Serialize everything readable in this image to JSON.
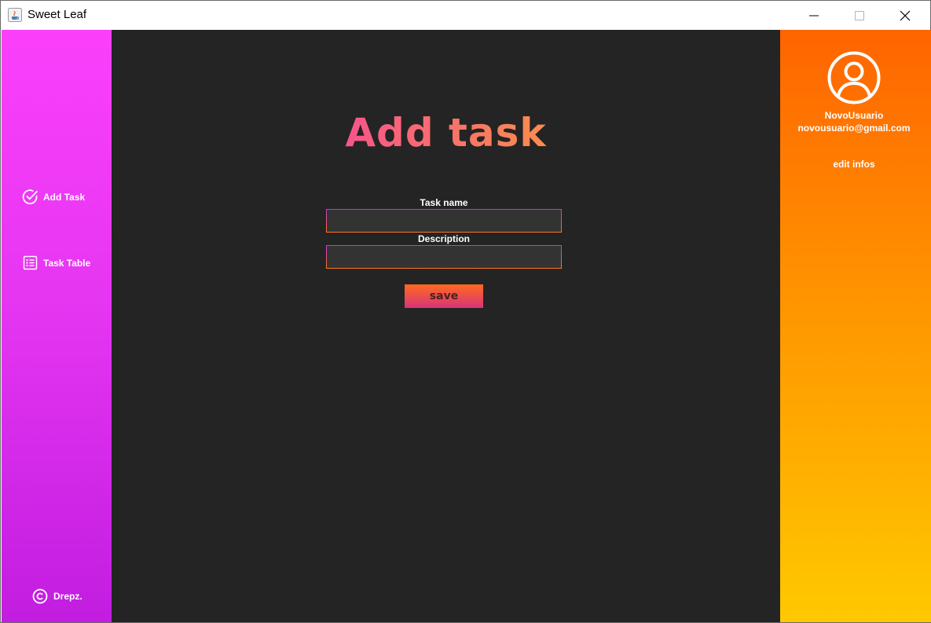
{
  "window": {
    "title": "Sweet Leaf",
    "icon": "java-cup-icon"
  },
  "sidebar": {
    "items": [
      {
        "label": "Add Task",
        "icon": "check-circle-icon"
      },
      {
        "label": "Task Table",
        "icon": "list-icon"
      }
    ],
    "credit": {
      "label": "Drepz.",
      "icon": "copyright-icon"
    },
    "color_top": "#fb3ffb",
    "color_bottom": "#c21de0"
  },
  "main": {
    "title": "Add task",
    "fields": [
      {
        "label": "Task name",
        "value": "",
        "placeholder": ""
      },
      {
        "label": "Description",
        "value": "",
        "placeholder": ""
      }
    ],
    "save_label": "save",
    "background": "#242424"
  },
  "profile": {
    "avatar_icon": "user-circle-icon",
    "username": "NovoUsuario",
    "email": "novousuario@gmail.com",
    "edit_label": "edit infos",
    "color_top": "#ff6400",
    "color_bottom": "#ffc900"
  }
}
